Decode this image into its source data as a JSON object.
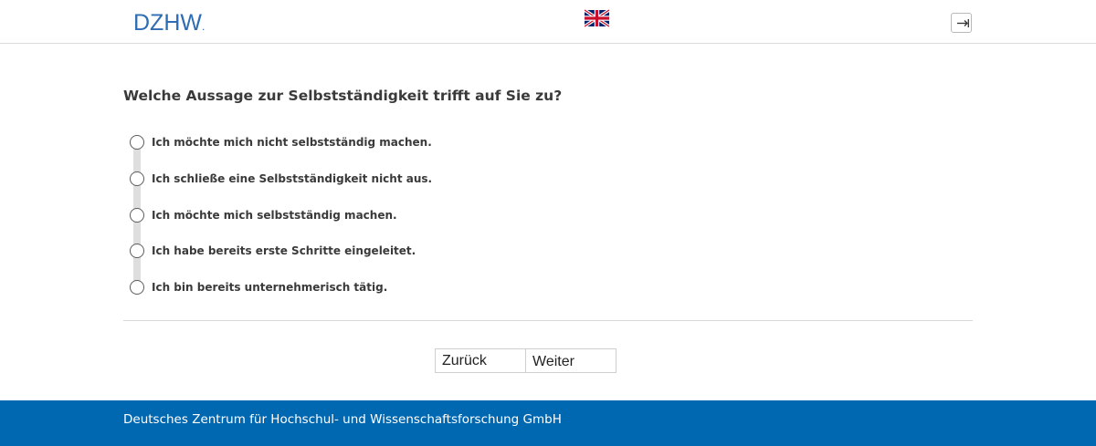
{
  "header": {
    "logo_text": "DZHW",
    "language_flag": "uk-flag-icon",
    "logout_icon": "logout-icon"
  },
  "question": {
    "text": "Welche Aussage zur Selbstständigkeit trifft auf Sie zu?",
    "options": [
      {
        "label": "Ich möchte mich nicht selbstständig machen.",
        "selected": false
      },
      {
        "label": "Ich schließe eine Selbstständigkeit nicht aus.",
        "selected": false
      },
      {
        "label": "Ich möchte mich selbstständig machen.",
        "selected": false
      },
      {
        "label": "Ich habe bereits erste Schritte eingeleitet.",
        "selected": false
      },
      {
        "label": "Ich bin bereits unternehmerisch tätig.",
        "selected": false
      }
    ]
  },
  "navigation": {
    "back_label": "Zurück",
    "next_label": "Weiter"
  },
  "footer": {
    "text": "Deutsches Zentrum für Hochschul- und Wissenschaftsforschung GmbH"
  },
  "colors": {
    "brand_blue": "#0067b1",
    "logo_blue": "#2e6db4"
  }
}
